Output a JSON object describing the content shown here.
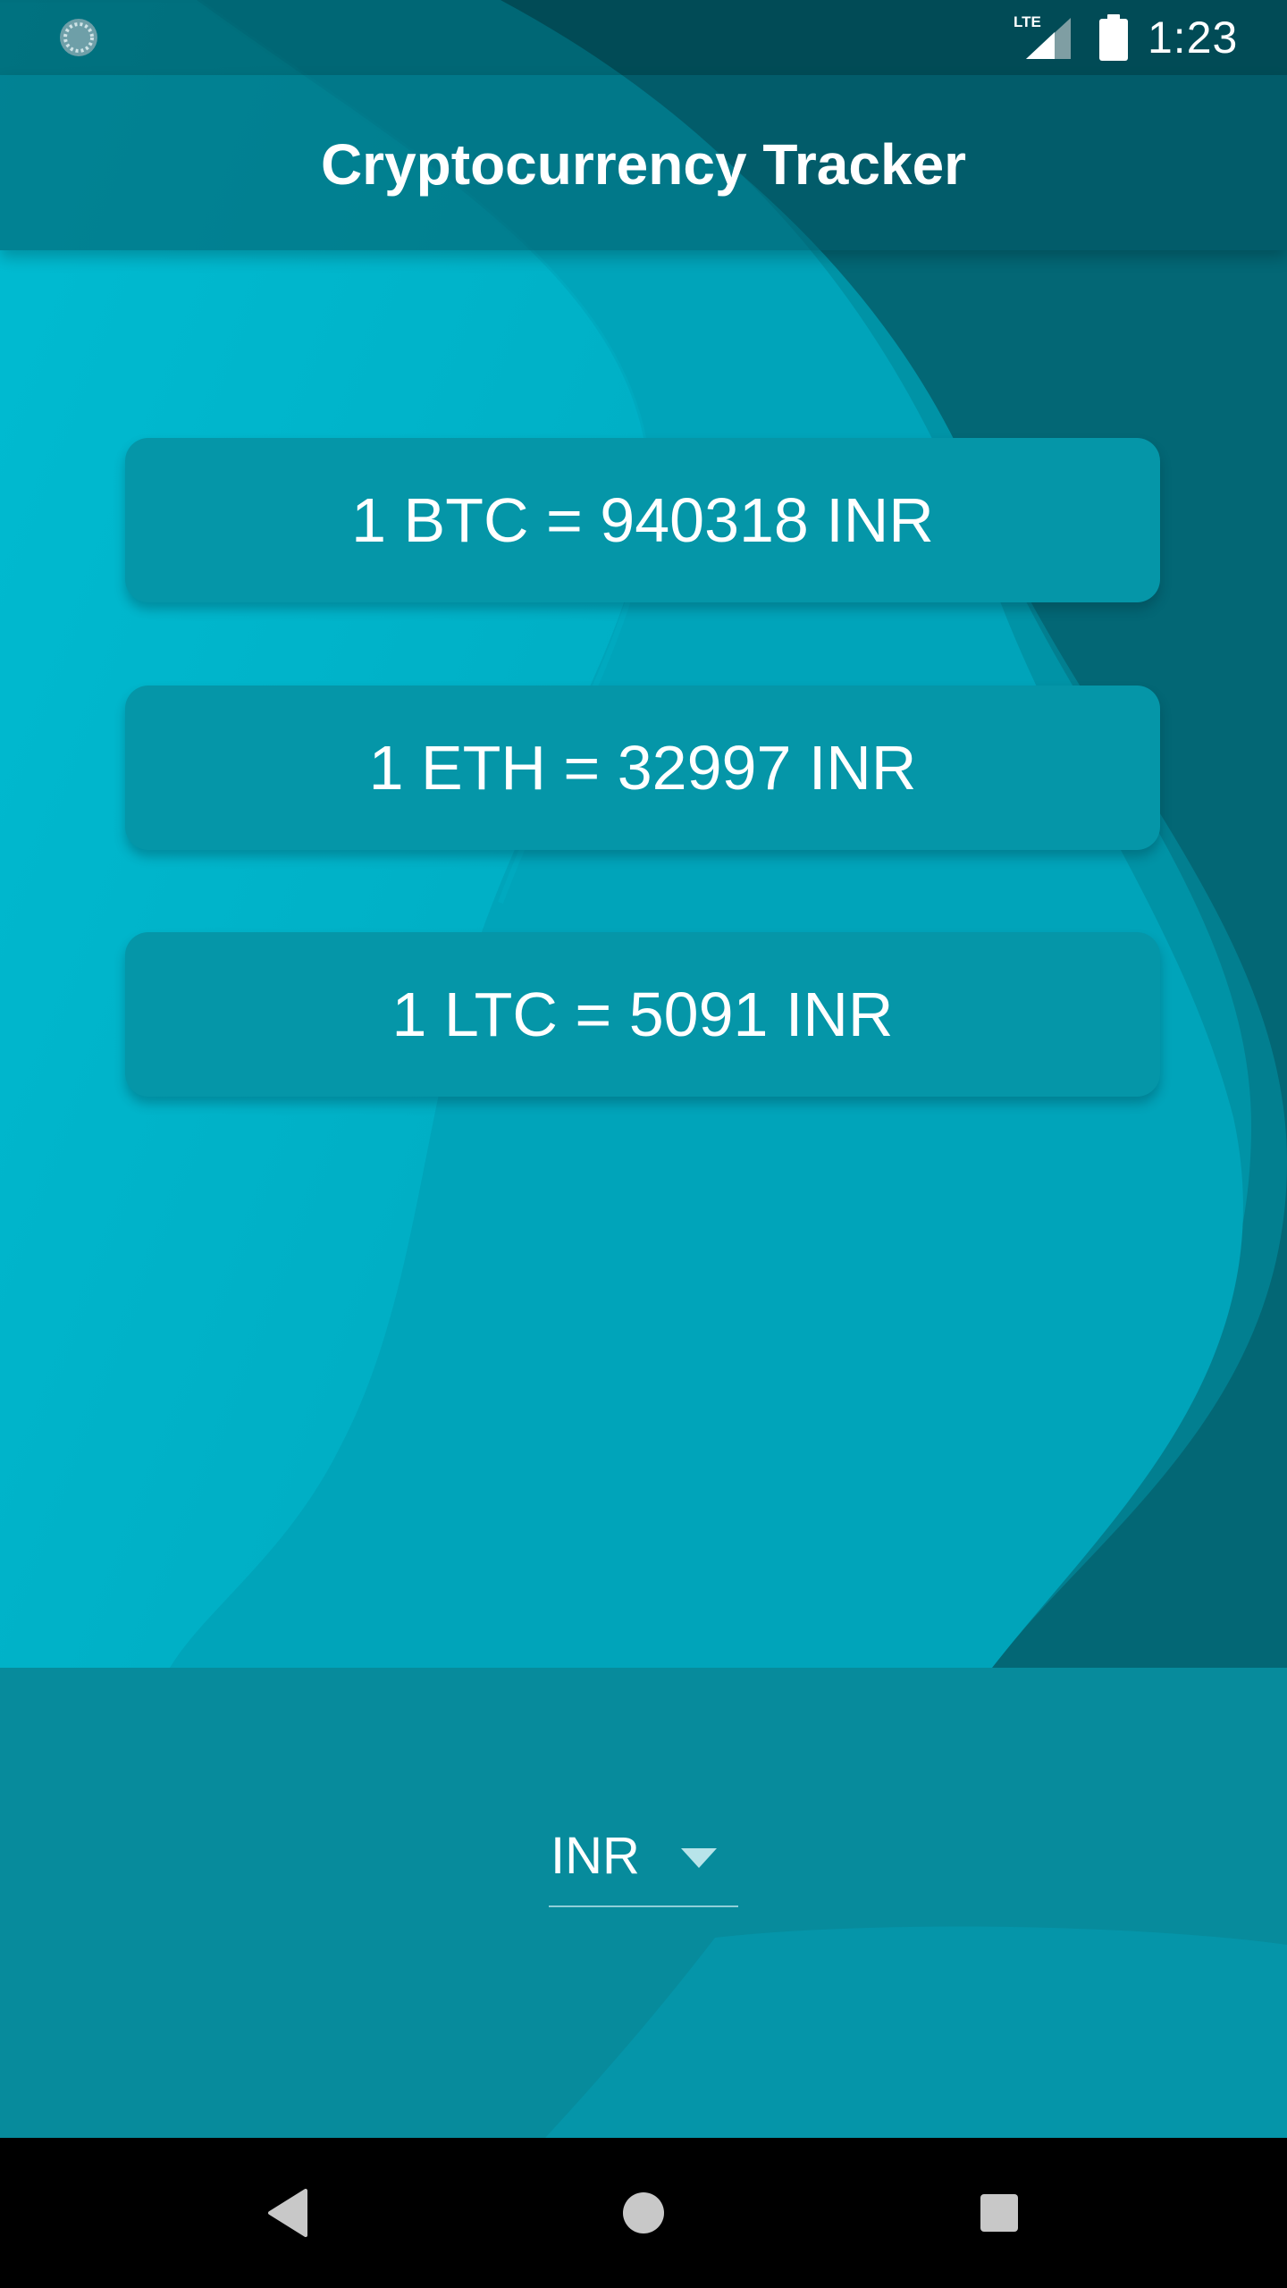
{
  "status_bar": {
    "time": "1:23",
    "network_label": "LTE",
    "icons": [
      "loading-icon",
      "lte-signal-icon",
      "battery-icon"
    ]
  },
  "app_bar": {
    "title": "Cryptocurrency Tracker"
  },
  "rates": [
    {
      "coin": "BTC",
      "label": "1 BTC = 940318 INR"
    },
    {
      "coin": "ETH",
      "label": "1 ETH = 32997 INR"
    },
    {
      "coin": "LTC",
      "label": "1 LTC = 5091 INR"
    }
  ],
  "currency_selector": {
    "selected": "INR",
    "icon": "dropdown-arrow-icon"
  },
  "nav_bar": {
    "icons": [
      "back-icon",
      "home-icon",
      "recents-icon"
    ]
  },
  "colors": {
    "background_teal": "#00a7bd",
    "card": "#0596a8",
    "bottom_panel": "#078b9c",
    "status_bar": "#00343c",
    "text": "#ffffff"
  }
}
